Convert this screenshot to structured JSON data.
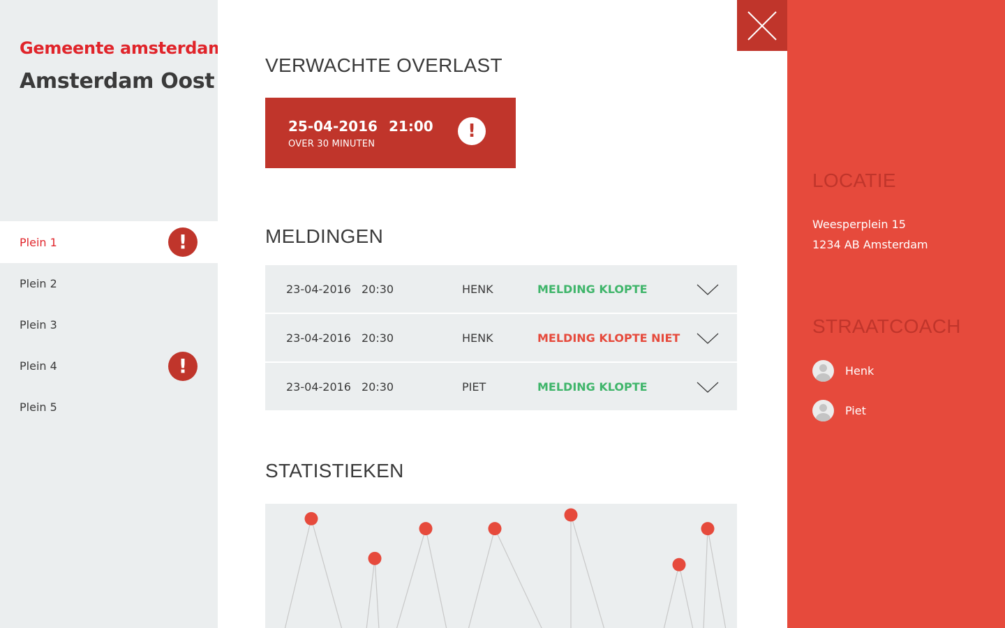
{
  "sidebar": {
    "org": "Gemeente amsterdam",
    "district": "Amsterdam Oost",
    "items": [
      {
        "label": "Plein 1",
        "alert": "!"
      },
      {
        "label": "Plein 2"
      },
      {
        "label": "Plein 3"
      },
      {
        "label": "Plein 4",
        "alert": "!"
      },
      {
        "label": "Plein 5"
      }
    ],
    "active_index": 0
  },
  "main": {
    "overlast": {
      "title": "VERWACHTE OVERLAST",
      "date": "25-04-2016",
      "time": "21:00",
      "sub": "OVER 30 MINUTEN",
      "icon": "!"
    },
    "meldingen": {
      "title": "MELDINGEN",
      "rows": [
        {
          "date": "23-04-2016",
          "time": "20:30",
          "name": "HENK",
          "status": "MELDING KLOPTE",
          "ok": true
        },
        {
          "date": "23-04-2016",
          "time": "20:30",
          "name": "HENK",
          "status": "MELDING KLOPTE NIET",
          "ok": false
        },
        {
          "date": "23-04-2016",
          "time": "20:30",
          "name": "PIET",
          "status": "MELDING KLOPTE",
          "ok": true
        }
      ]
    },
    "statistieken": {
      "title": "STATISTIEKEN"
    }
  },
  "chart_data": {
    "type": "line",
    "title": "",
    "xlabel": "",
    "ylabel": "",
    "x": [
      1,
      2,
      3,
      4,
      5,
      6,
      7
    ],
    "values": [
      0.88,
      0.56,
      0.8,
      0.8,
      0.91,
      0.51,
      0.8
    ],
    "ylim": [
      0,
      1
    ],
    "grid": false,
    "point_color": "#e64a3c",
    "line_color": "#c8c8c8"
  },
  "panel": {
    "locatie_title": "LOCATIE",
    "address_line1": "Weesperplein 15",
    "address_line2": "1234 AB Amsterdam",
    "straatcoach_title": "STRAATCOACH",
    "coaches": [
      "Henk",
      "Piet"
    ]
  },
  "colors": {
    "brand_red": "#e0242a",
    "dark_red": "#c0352b",
    "panel_red": "#e64a3c",
    "ok_green": "#3fb56a",
    "sidebar_bg": "#ebeeef"
  },
  "icons": {
    "close": "close-icon",
    "chevron": "chevron-down-icon",
    "alert": "alert-icon",
    "avatar": "user-avatar-icon"
  }
}
